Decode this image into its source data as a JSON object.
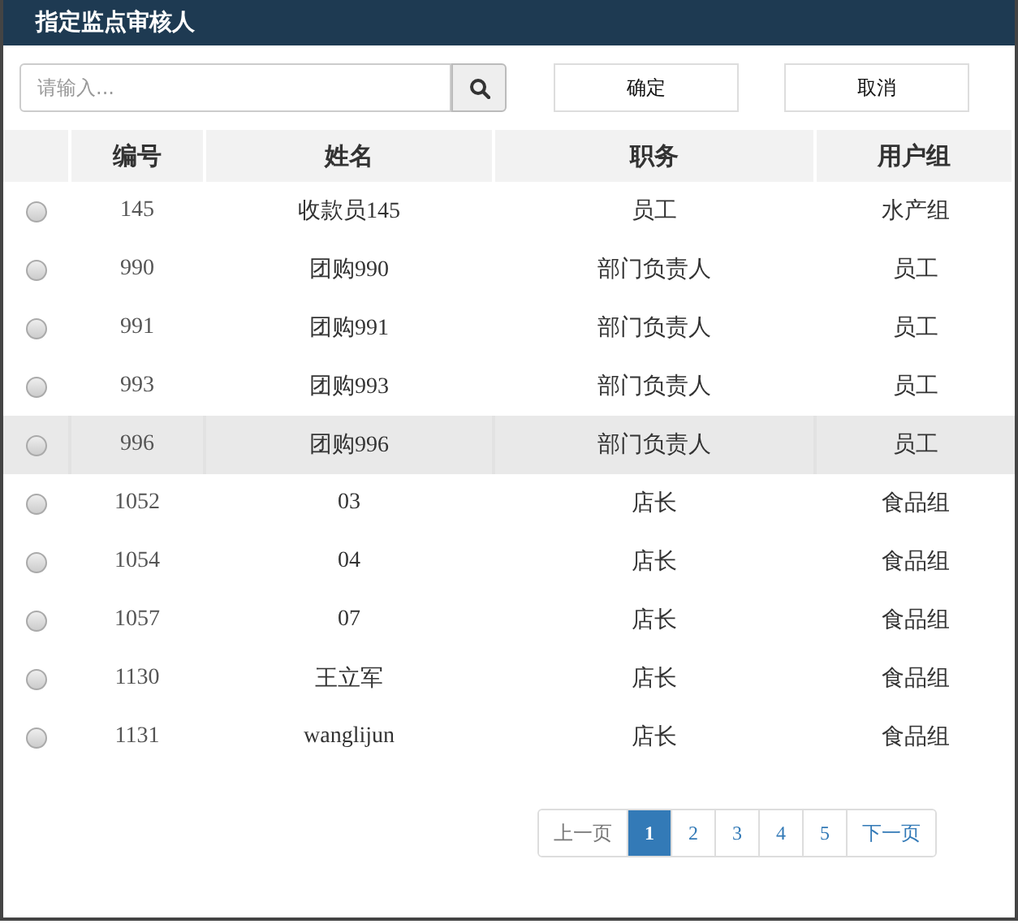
{
  "window": {
    "title": "指定监点审核人"
  },
  "search": {
    "placeholder": "请输入..."
  },
  "buttons": [
    "确定",
    "取消"
  ],
  "table": {
    "columns": [
      "编号",
      "姓名",
      "职务",
      "用户组"
    ],
    "rows": [
      {
        "selected": false,
        "highlighted": false,
        "cells": [
          "145",
          "收款员145",
          "员工",
          "水产组"
        ]
      },
      {
        "selected": false,
        "highlighted": false,
        "cells": [
          "990",
          "团购990",
          "部门负责人",
          "员工"
        ]
      },
      {
        "selected": false,
        "highlighted": false,
        "cells": [
          "991",
          "团购991",
          "部门负责人",
          "员工"
        ]
      },
      {
        "selected": false,
        "highlighted": false,
        "cells": [
          "993",
          "团购993",
          "部门负责人",
          "员工"
        ]
      },
      {
        "selected": false,
        "highlighted": true,
        "cells": [
          "996",
          "团购996",
          "部门负责人",
          "员工"
        ]
      },
      {
        "selected": false,
        "highlighted": false,
        "cells": [
          "1052",
          "03",
          "店长",
          "食品组"
        ]
      },
      {
        "selected": false,
        "highlighted": false,
        "cells": [
          "1054",
          "04",
          "店长",
          "食品组"
        ]
      },
      {
        "selected": false,
        "highlighted": false,
        "cells": [
          "1057",
          "07",
          "店长",
          "食品组"
        ]
      },
      {
        "selected": false,
        "highlighted": false,
        "cells": [
          "1130",
          "王立军",
          "店长",
          "食品组"
        ]
      },
      {
        "selected": false,
        "highlighted": false,
        "cells": [
          "1131",
          "wanglijun",
          "店长",
          "食品组"
        ]
      }
    ]
  },
  "pagination": {
    "prev": {
      "label": "上一页",
      "disabled": true
    },
    "pages": [
      {
        "label": "1",
        "selected": true
      },
      {
        "label": "2",
        "selected": false
      },
      {
        "label": "3",
        "selected": false
      },
      {
        "label": "4",
        "selected": false
      },
      {
        "label": "5",
        "selected": false
      }
    ],
    "next": {
      "label": "下一页",
      "disabled": false
    }
  }
}
